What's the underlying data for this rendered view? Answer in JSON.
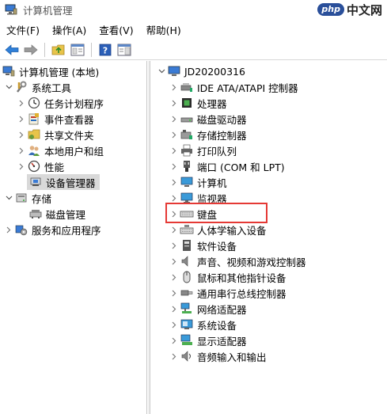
{
  "window": {
    "title": "计算机管理"
  },
  "watermark": {
    "badge": "php",
    "text": "中文网"
  },
  "menu": [
    "文件(F)",
    "操作(A)",
    "查看(V)",
    "帮助(H)"
  ],
  "left_tree": [
    {
      "label": "计算机管理 (本地)",
      "icon": "computer-management-icon",
      "level": 0,
      "chevron": ""
    },
    {
      "label": "系统工具",
      "icon": "tools-icon",
      "level": 1,
      "chevron": "down"
    },
    {
      "label": "任务计划程序",
      "icon": "clock-icon",
      "level": 2,
      "chevron": "right"
    },
    {
      "label": "事件查看器",
      "icon": "event-viewer-icon",
      "level": 2,
      "chevron": "right"
    },
    {
      "label": "共享文件夹",
      "icon": "shared-folder-icon",
      "level": 2,
      "chevron": "right"
    },
    {
      "label": "本地用户和组",
      "icon": "users-icon",
      "level": 2,
      "chevron": "right"
    },
    {
      "label": "性能",
      "icon": "performance-icon",
      "level": 2,
      "chevron": "right"
    },
    {
      "label": "设备管理器",
      "icon": "device-manager-icon",
      "level": 2,
      "chevron": "",
      "selected": true
    },
    {
      "label": "存储",
      "icon": "storage-icon",
      "level": 0,
      "chevron": "down"
    },
    {
      "label": "磁盘管理",
      "icon": "disk-management-icon",
      "level": 2,
      "chevron": ""
    },
    {
      "label": "服务和应用程序",
      "icon": "services-icon",
      "level": 0,
      "chevron": "right"
    }
  ],
  "right_tree": {
    "root": "JD20200316",
    "items": [
      {
        "label": "IDE ATA/ATAPI 控制器",
        "icon": "ide-controller-icon"
      },
      {
        "label": "处理器",
        "icon": "processor-icon"
      },
      {
        "label": "磁盘驱动器",
        "icon": "disk-drive-icon"
      },
      {
        "label": "存储控制器",
        "icon": "storage-controller-icon"
      },
      {
        "label": "打印队列",
        "icon": "printer-icon"
      },
      {
        "label": "端口 (COM 和 LPT)",
        "icon": "port-icon"
      },
      {
        "label": "计算机",
        "icon": "computer-icon"
      },
      {
        "label": "监视器",
        "icon": "monitor-icon"
      },
      {
        "label": "键盘",
        "icon": "keyboard-icon"
      },
      {
        "label": "人体学输入设备",
        "icon": "hid-icon"
      },
      {
        "label": "软件设备",
        "icon": "software-device-icon"
      },
      {
        "label": "声音、视频和游戏控制器",
        "icon": "sound-icon"
      },
      {
        "label": "鼠标和其他指针设备",
        "icon": "mouse-icon"
      },
      {
        "label": "通用串行总线控制器",
        "icon": "usb-icon"
      },
      {
        "label": "网络适配器",
        "icon": "network-adapter-icon"
      },
      {
        "label": "系统设备",
        "icon": "system-device-icon"
      },
      {
        "label": "显示适配器",
        "icon": "display-adapter-icon"
      },
      {
        "label": "音频输入和输出",
        "icon": "audio-io-icon"
      }
    ]
  },
  "highlight_color": "#e53935"
}
